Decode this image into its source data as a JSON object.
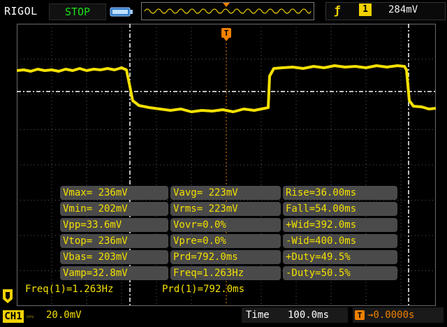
{
  "header": {
    "brand": "RIGOL",
    "run_state": "STOP",
    "trigger": {
      "edge_icon": "rising-edge-icon",
      "channel": "1",
      "level": "284mV"
    }
  },
  "trigger_marker": "T",
  "measurements": [
    [
      "Vmax= 236mV",
      "Vavg= 223mV",
      "Rise=36.00ms"
    ],
    [
      "Vmin= 202mV",
      "Vrms= 223mV",
      "Fall=54.00ms"
    ],
    [
      "Vpp=33.6mV",
      "Vovr=0.0%",
      "+Wid=392.0ms"
    ],
    [
      "Vtop= 236mV",
      "Vpre=0.0%",
      "-Wid=400.0ms"
    ],
    [
      "Vbas= 203mV",
      "Prd=792.0ms",
      "+Duty=49.5%"
    ],
    [
      "Vamp=32.8mV",
      "Freq=1.263Hz",
      "-Duty=50.5%"
    ]
  ],
  "footer_readout": {
    "freq": "Freq(1)=1.263Hz",
    "prd": "Prd(1)=792.0ms"
  },
  "status_bar": {
    "channel": "CH1",
    "coupling_icon": "dc-coupling-icon",
    "volts_per_div": "20.0mV",
    "time_label": "Time",
    "time_per_div": "100.0ms",
    "trigger_offset": "0.0000s"
  },
  "colors": {
    "trace": "#f4e000",
    "grid": "#5a5a5a",
    "run_state": "#18e018",
    "trigger": "#f08000"
  }
}
